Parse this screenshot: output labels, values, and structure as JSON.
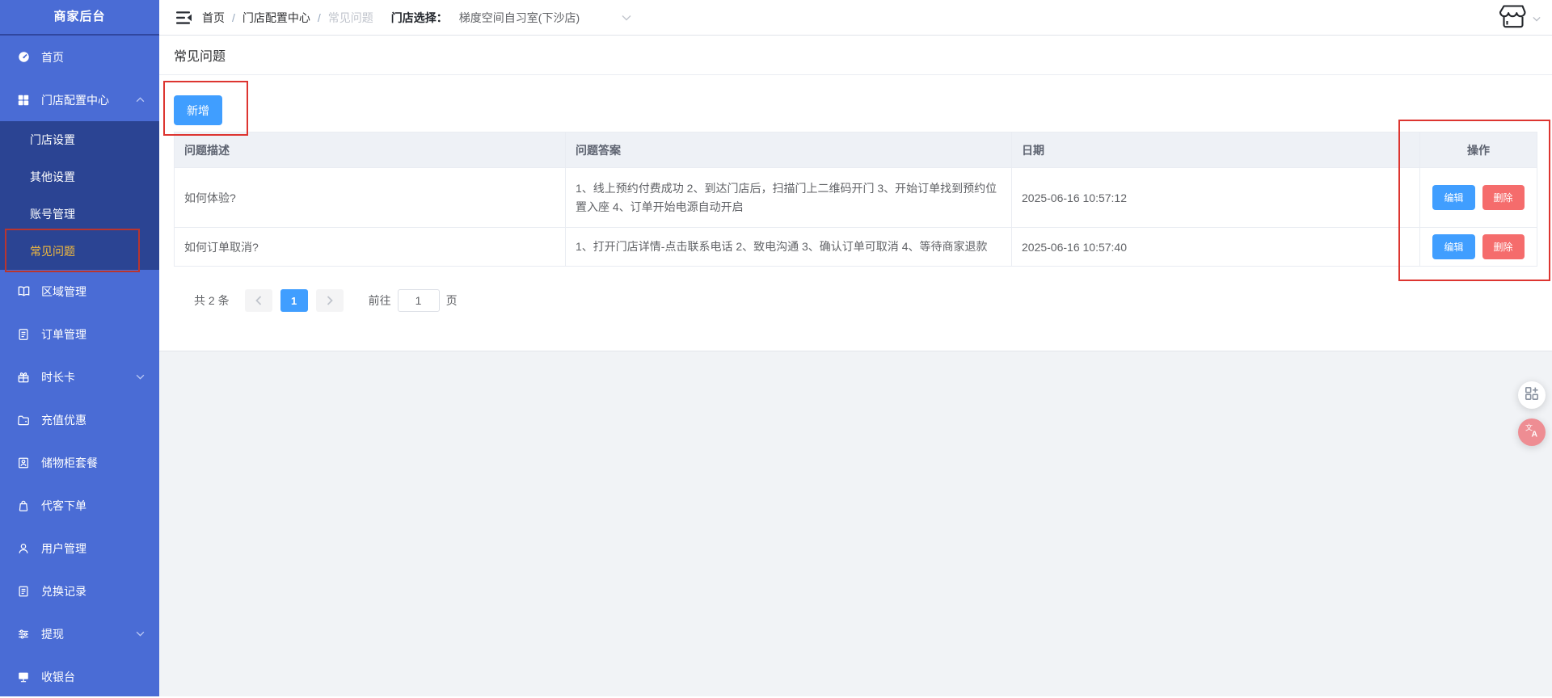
{
  "colors": {
    "primary": "#409eff",
    "danger": "#f56c6c",
    "sidebar_bg": "#4a6cd5",
    "sidebar_submenu_bg": "#2b4493",
    "sidebar_active_text": "#f6bc3b",
    "annotation_red": "#dd3530",
    "page_bg": "#f1f3f6",
    "table_header_bg": "#eef1f6"
  },
  "sidebar": {
    "title": "商家后台",
    "items": [
      {
        "label": "首页",
        "icon": "dashboard-icon"
      },
      {
        "label": "门店配置中心",
        "icon": "grid-icon",
        "state": "expanded"
      },
      {
        "label": "区域管理",
        "icon": "book-icon"
      },
      {
        "label": "订单管理",
        "icon": "document-icon"
      },
      {
        "label": "时长卡",
        "icon": "gift-icon",
        "state": "collapsed"
      },
      {
        "label": "充值优惠",
        "icon": "wallet-icon"
      },
      {
        "label": "储物柜套餐",
        "icon": "locker-icon"
      },
      {
        "label": "代客下单",
        "icon": "bag-icon"
      },
      {
        "label": "用户管理",
        "icon": "user-icon"
      },
      {
        "label": "兑换记录",
        "icon": "list-icon"
      },
      {
        "label": "提现",
        "icon": "sliders-icon",
        "state": "collapsed"
      },
      {
        "label": "收银台",
        "icon": "monitor-icon"
      }
    ],
    "submenu": {
      "parent": "门店配置中心",
      "items": [
        "门店设置",
        "其他设置",
        "账号管理",
        "常见问题"
      ],
      "active": "常见问题"
    }
  },
  "topbar": {
    "breadcrumb": {
      "items": [
        "首页",
        "门店配置中心",
        "常见问题"
      ],
      "separator": "/"
    },
    "store_select": {
      "label": "门店选择：",
      "value": "梯度空间自习室(下沙店)"
    }
  },
  "page": {
    "title": "常见问题",
    "add_button": "新增"
  },
  "table": {
    "headers": [
      "问题描述",
      "问题答案",
      "日期",
      "操作"
    ],
    "rows": [
      {
        "question": "如何体验?",
        "answer": "1、线上预约付费成功 2、到达门店后，扫描门上二维码开门 3、开始订单找到预约位置入座 4、订单开始电源自动开启",
        "date": "2025-06-16 10:57:12",
        "edit": "编辑",
        "delete": "删除"
      },
      {
        "question": "如何订单取消?",
        "answer": "1、打开门店详情-点击联系电话 2、致电沟通 3、确认订单可取消 4、等待商家退款",
        "date": "2025-06-16 10:57:40",
        "edit": "编辑",
        "delete": "删除"
      }
    ]
  },
  "pagination": {
    "total": "共 2 条",
    "page": "1",
    "goto": "前往",
    "goto_value": "1",
    "unit": "页"
  }
}
